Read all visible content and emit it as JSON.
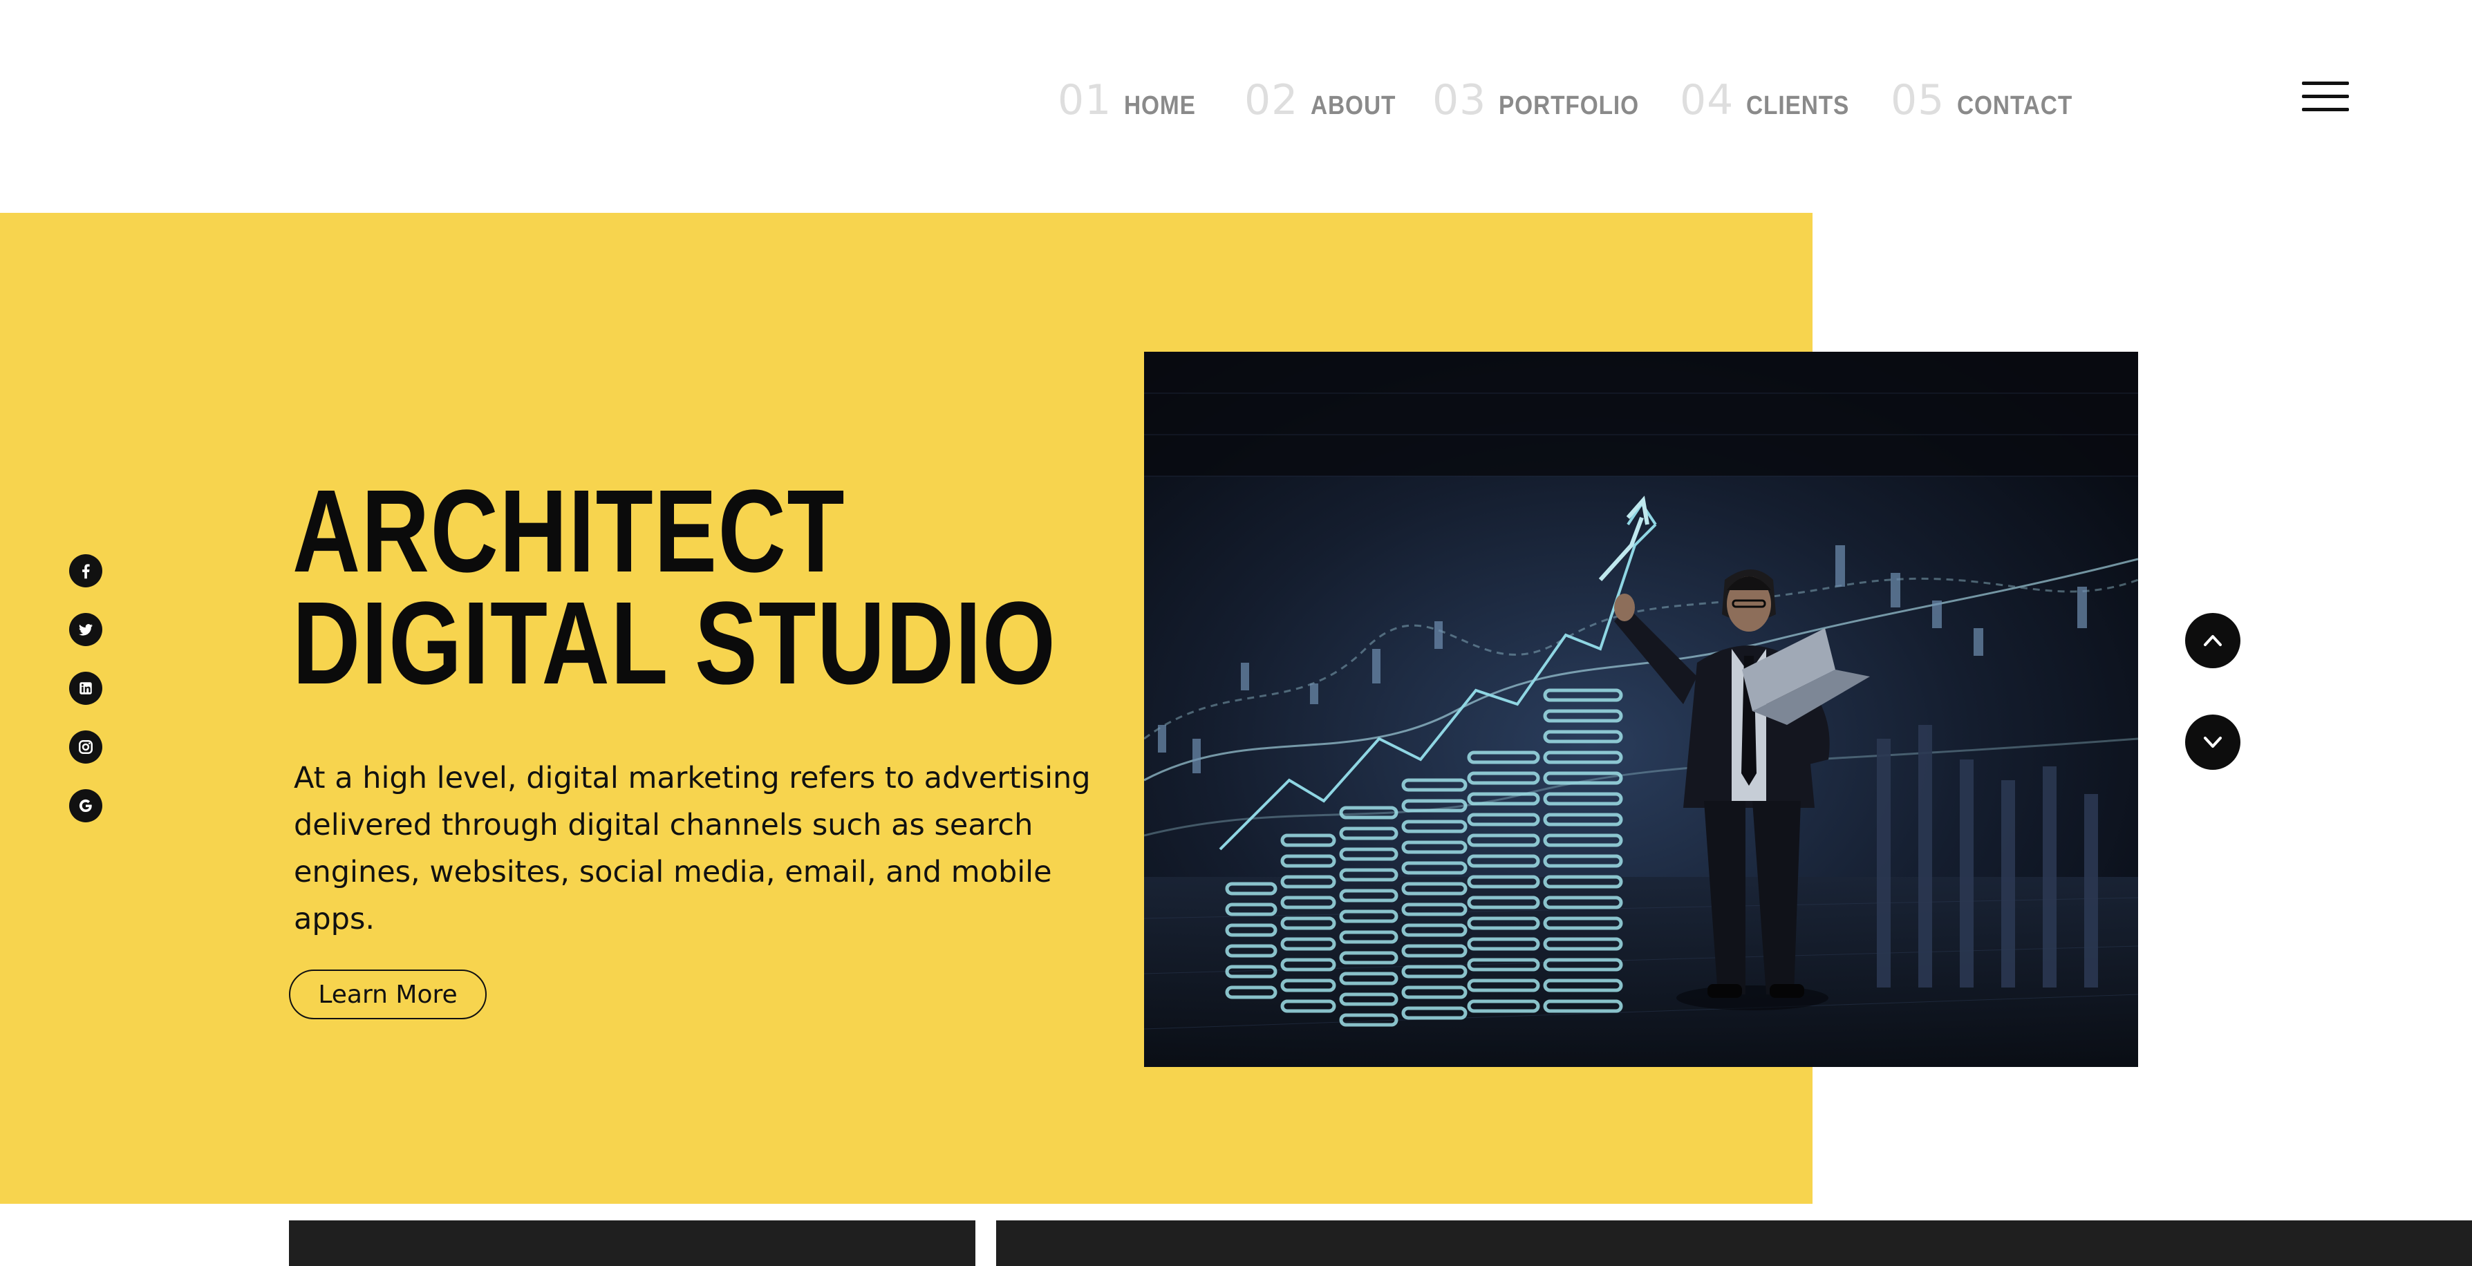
{
  "nav": {
    "items": [
      {
        "num": "01",
        "label": "HOME"
      },
      {
        "num": "02",
        "label": "ABOUT"
      },
      {
        "num": "03",
        "label": "PORTFOLIO"
      },
      {
        "num": "04",
        "label": "CLIENTS"
      },
      {
        "num": "05",
        "label": "CONTACT"
      }
    ],
    "menu_icon": "hamburger-icon"
  },
  "hero": {
    "title_line1": "ARCHITECT",
    "title_line2": "DIGITAL STUDIO",
    "description": "At a high level, digital marketing refers to advertising delivered through digital channels such as search engines, websites, social media, email, and mobile apps.",
    "button_label": "Learn More",
    "accent_color": "#f7d44e"
  },
  "social": [
    "facebook-icon",
    "twitter-icon",
    "linkedin-icon",
    "instagram-icon",
    "google-icon"
  ],
  "scroll": {
    "up_icon": "chevron-up-icon",
    "down_icon": "chevron-down-icon"
  }
}
